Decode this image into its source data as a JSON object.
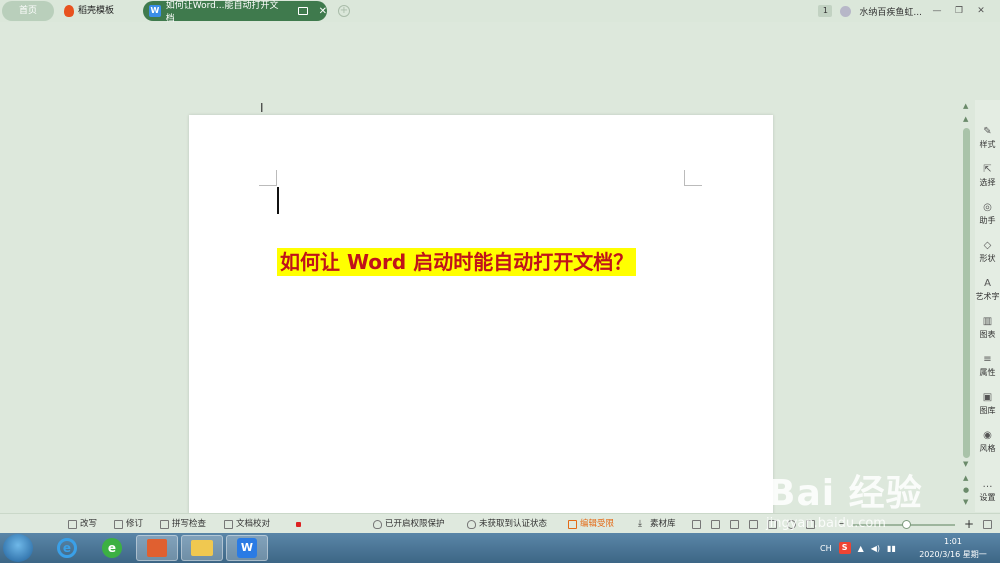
{
  "tabs": {
    "home_label": "首页",
    "templates_label": "稻壳模板",
    "doc_title": "如何让Word...能自动打开文档",
    "doc_logo": "W",
    "add_symbol": "+",
    "close_symbol": "✕"
  },
  "topright": {
    "badge": "1",
    "user_name": "水纳百疾鱼虹...",
    "min": "—",
    "restore": "❐",
    "close": "✕"
  },
  "editor": {
    "cursor_glyph": "I",
    "headline": "如何让 Word 启动时能自动打开文档？"
  },
  "sidepanel": {
    "items": [
      {
        "label": "样式",
        "icon": "✎"
      },
      {
        "label": "选择",
        "icon": "⇱"
      },
      {
        "label": "助手",
        "icon": "◎"
      },
      {
        "label": "形状",
        "icon": "◇"
      },
      {
        "label": "艺术字",
        "icon": "A"
      },
      {
        "label": "图表",
        "icon": "▥"
      },
      {
        "label": "属性",
        "icon": "≡"
      },
      {
        "label": "图库",
        "icon": "▣"
      },
      {
        "label": "风格",
        "icon": "◉"
      },
      {
        "label": "设置",
        "icon": "…"
      }
    ]
  },
  "statusbar": {
    "revise": "改写",
    "track": "修订",
    "spell": "拼写检查",
    "proof": "文档校对",
    "protect": "已开启权限保护",
    "cert": "未获取到认证状态",
    "edit_mode": "编辑受限",
    "materials": "素材库",
    "zoom_minus": "−",
    "zoom_plus": "+"
  },
  "watermark": {
    "brand": "Bai 经验",
    "url": "jingyan.baidu.com"
  },
  "taskbar": {
    "ie": "e",
    "green": "e",
    "wps": "W",
    "lang": "CH",
    "sogou": "S",
    "time": "1:01",
    "date": "2020/3/16 星期一"
  },
  "colors": {
    "accent": "#3f7a4d",
    "headline_text": "#c0121a",
    "headline_bg": "#ffff00"
  }
}
